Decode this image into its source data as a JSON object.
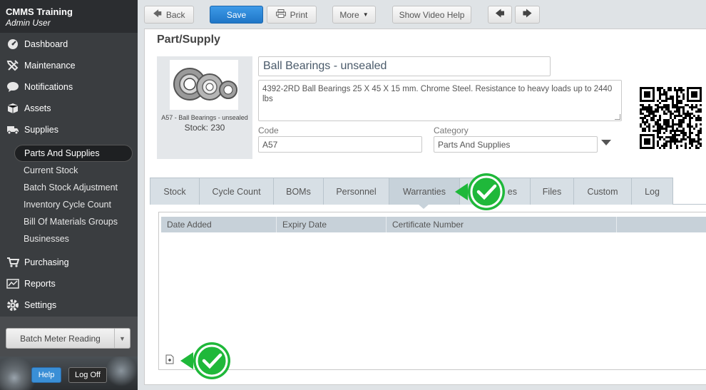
{
  "sidebar": {
    "brand": "CMMS Training",
    "user": "Admin User",
    "nav": [
      {
        "label": "Dashboard",
        "icon": "dashboard-icon"
      },
      {
        "label": "Maintenance",
        "icon": "tools-icon"
      },
      {
        "label": "Notifications",
        "icon": "chat-bubble-icon"
      },
      {
        "label": "Assets",
        "icon": "box-icon"
      },
      {
        "label": "Supplies",
        "icon": "truck-icon"
      }
    ],
    "sub_nav": [
      {
        "label": "Parts And Supplies",
        "active": true
      },
      {
        "label": "Current Stock"
      },
      {
        "label": "Batch Stock Adjustment"
      },
      {
        "label": "Inventory Cycle Count"
      },
      {
        "label": "Bill Of Materials Groups"
      },
      {
        "label": "Businesses"
      }
    ],
    "nav_bottom": [
      {
        "label": "Purchasing",
        "icon": "cart-icon"
      },
      {
        "label": "Reports",
        "icon": "chart-icon"
      },
      {
        "label": "Settings",
        "icon": "gear-icon"
      }
    ],
    "batch_meter": "Batch Meter Reading",
    "help": "Help",
    "log_off": "Log Off"
  },
  "toolbar": {
    "back": "Back",
    "save": "Save",
    "print": "Print",
    "more": "More",
    "video_help": "Show Video Help"
  },
  "page": {
    "title": "Part/Supply",
    "image_caption": "A57 - Ball Bearings - unsealed",
    "stock": "Stock: 230",
    "name": "Ball Bearings - unsealed",
    "description": "4392-2RD Ball Bearings 25 X 45 X 15 mm. Chrome Steel. Resistance to heavy loads up to 2440 lbs",
    "code_label": "Code",
    "code_value": "A57",
    "category_label": "Category",
    "category_value": "Parts And Supplies"
  },
  "tabs": [
    {
      "label": "Stock"
    },
    {
      "label": "Cycle Count"
    },
    {
      "label": "BOMs"
    },
    {
      "label": "Personnel"
    },
    {
      "label": "Warranties",
      "active": true
    },
    {
      "label": "es"
    },
    {
      "label": "Files"
    },
    {
      "label": "Custom"
    },
    {
      "label": "Log"
    }
  ],
  "grid": {
    "columns": [
      "Date Added",
      "Expiry Date",
      "Certificate Number",
      ""
    ]
  },
  "colors": {
    "save": "#2a87da",
    "callout_green": "#1fb83a",
    "sidebar": "#3a3d40"
  }
}
